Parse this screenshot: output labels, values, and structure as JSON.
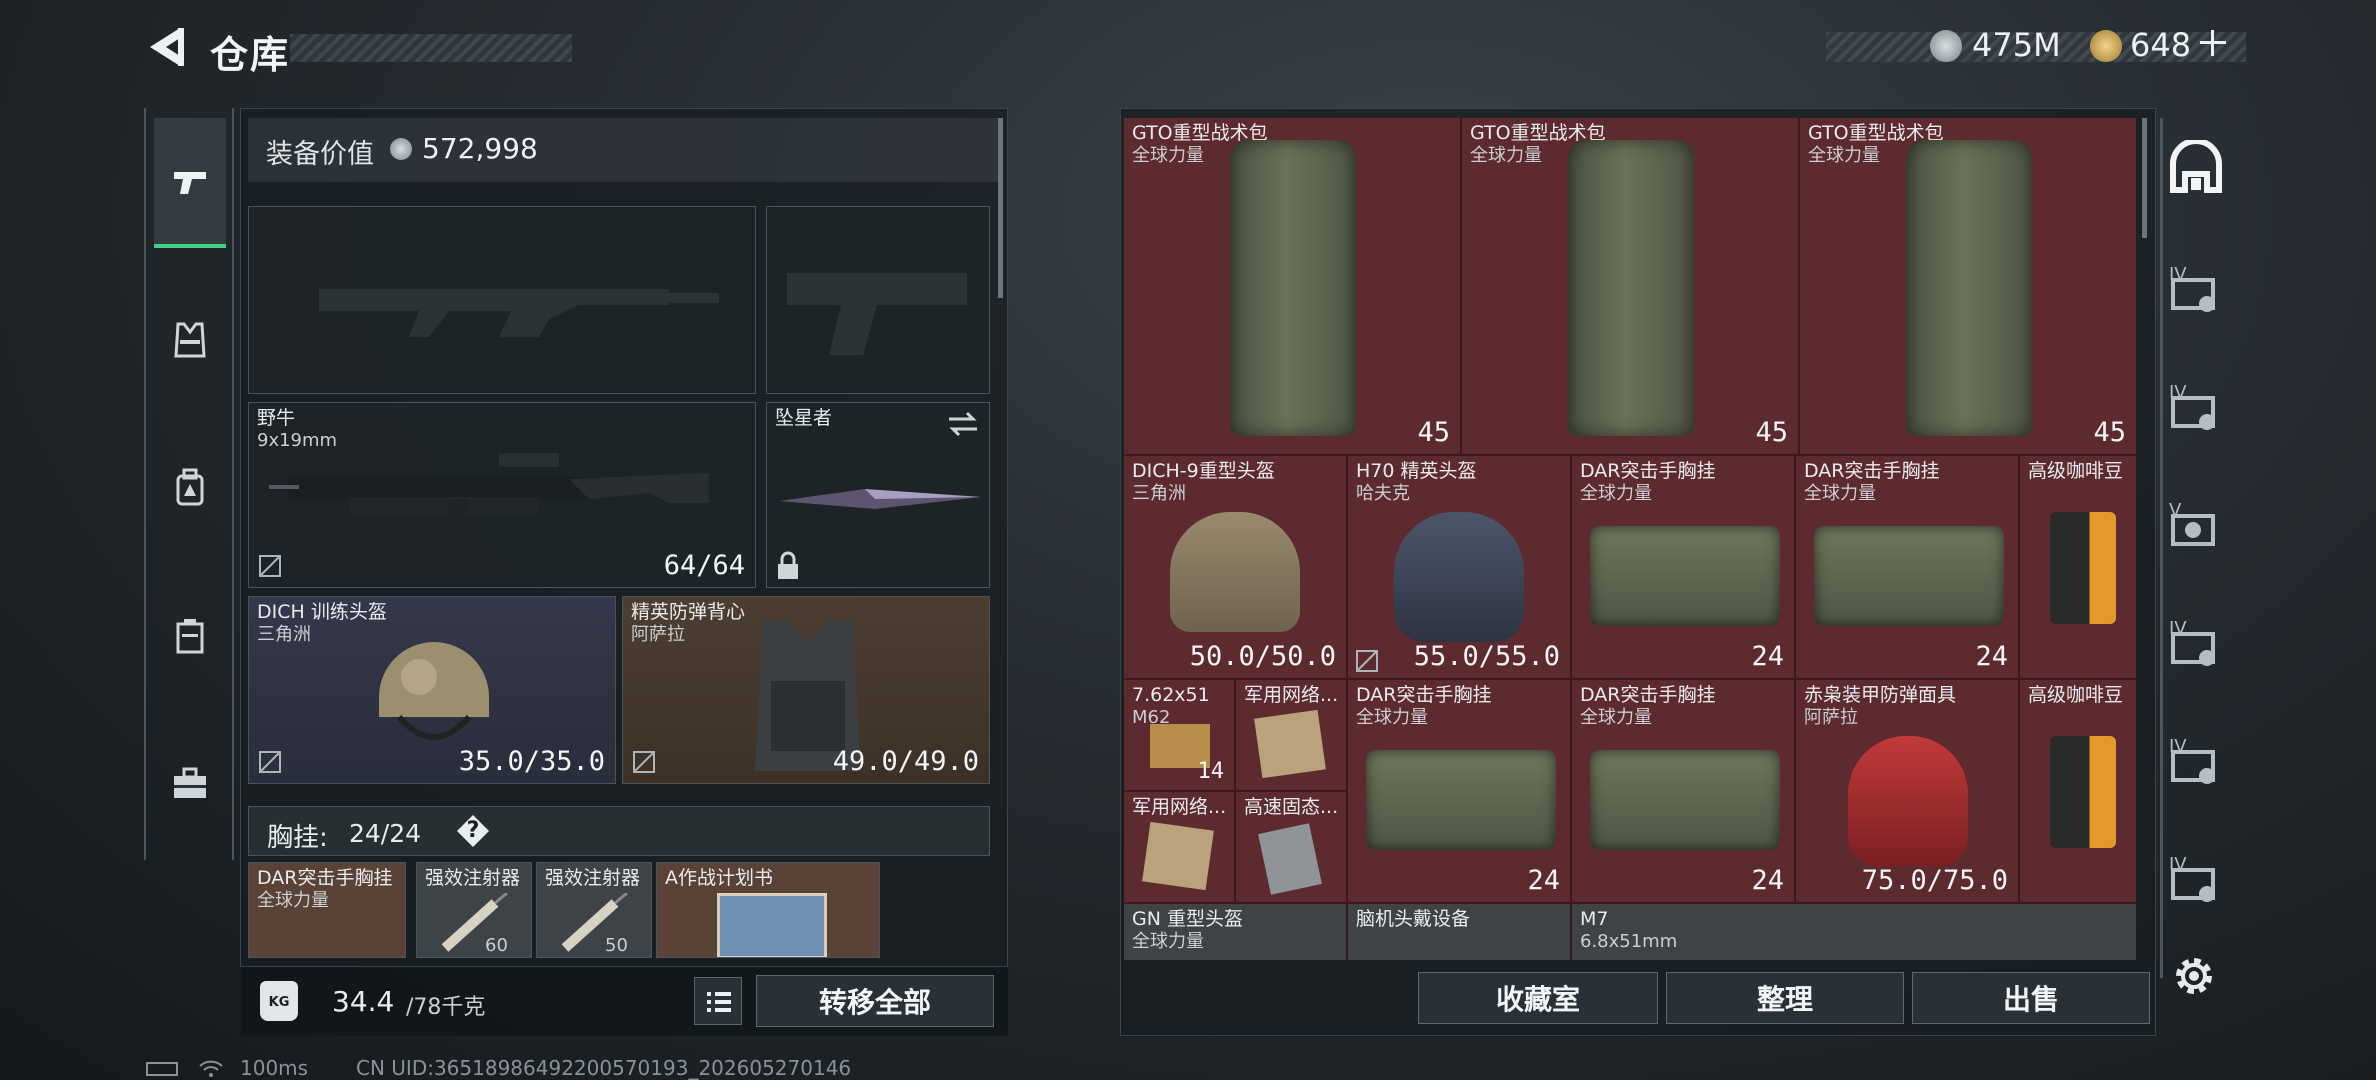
{
  "header": {
    "back_label": "仓库",
    "currency_primary": "475M",
    "currency_secondary": "648"
  },
  "loadout": {
    "value_label": "装备价值",
    "value": "572,998",
    "primary_weapon": {
      "name": "野牛",
      "caliber": "9x19mm",
      "ammo": "64/64"
    },
    "melee": {
      "name": "坠星者"
    },
    "helmet": {
      "name": "DICH 训练头盔",
      "map": "三角洲",
      "durability": "35.0/35.0"
    },
    "armor": {
      "name": "精英防弹背心",
      "map": "阿萨拉",
      "durability": "49.0/49.0"
    },
    "chest_rig": {
      "label": "胸挂:",
      "capacity": "24/24",
      "help": "?"
    },
    "rig_items": [
      {
        "name": "DAR突击手胸挂",
        "sub": "全球力量"
      },
      {
        "name": "强效注射器",
        "amount": "60"
      },
      {
        "name": "强效注射器",
        "amount": "50"
      },
      {
        "name": "A作战计划书"
      }
    ],
    "weight": "34.4",
    "weight_cap": "/78千克",
    "transfer_all": "转移全部"
  },
  "storage": {
    "cells": [
      {
        "name": "GTO重型战术包",
        "sub": "全球力量",
        "value": "45"
      },
      {
        "name": "GTO重型战术包",
        "sub": "全球力量",
        "value": "45"
      },
      {
        "name": "GTO重型战术包",
        "sub": "全球力量",
        "value": "45"
      },
      {
        "name": "DICH-9重型头盔",
        "sub": "三角洲",
        "value": "50.0/50.0"
      },
      {
        "name": "H70 精英头盔",
        "sub": "哈夫克",
        "value": "55.0/55.0"
      },
      {
        "name": "DAR突击手胸挂",
        "sub": "全球力量",
        "value": "24"
      },
      {
        "name": "DAR突击手胸挂",
        "sub": "全球力量",
        "value": "24"
      },
      {
        "name": "高级咖啡豆"
      },
      {
        "name": "7.62x51",
        "sub": "M62",
        "value": "14"
      },
      {
        "name": "军用网络..."
      },
      {
        "name": "DAR突击手胸挂",
        "sub": "全球力量",
        "value": "24"
      },
      {
        "name": "DAR突击手胸挂",
        "sub": "全球力量",
        "value": "24"
      },
      {
        "name": "赤枭装甲防弹面具",
        "sub": "阿萨拉",
        "value": "75.0/75.0"
      },
      {
        "name": "高级咖啡豆"
      },
      {
        "name": "军用网络..."
      },
      {
        "name": "高速固态..."
      },
      {
        "name": "GN 重型头盔",
        "sub": "全球力量"
      },
      {
        "name": "脑机头戴设备"
      },
      {
        "name": "M7",
        "sub": "6.8x51mm"
      }
    ],
    "buttons": {
      "collection": "收藏室",
      "sort": "整理",
      "sell": "出售"
    }
  },
  "side_tabs": [
    "IV",
    "IV",
    "V",
    "IV",
    "IV",
    "IV"
  ],
  "status": {
    "ping": "100ms",
    "uid": "CN UID:36518986492200570193_202605270146"
  },
  "colors": {
    "accent_green": "#3fd08a",
    "storage_red": "#5d2a30"
  }
}
